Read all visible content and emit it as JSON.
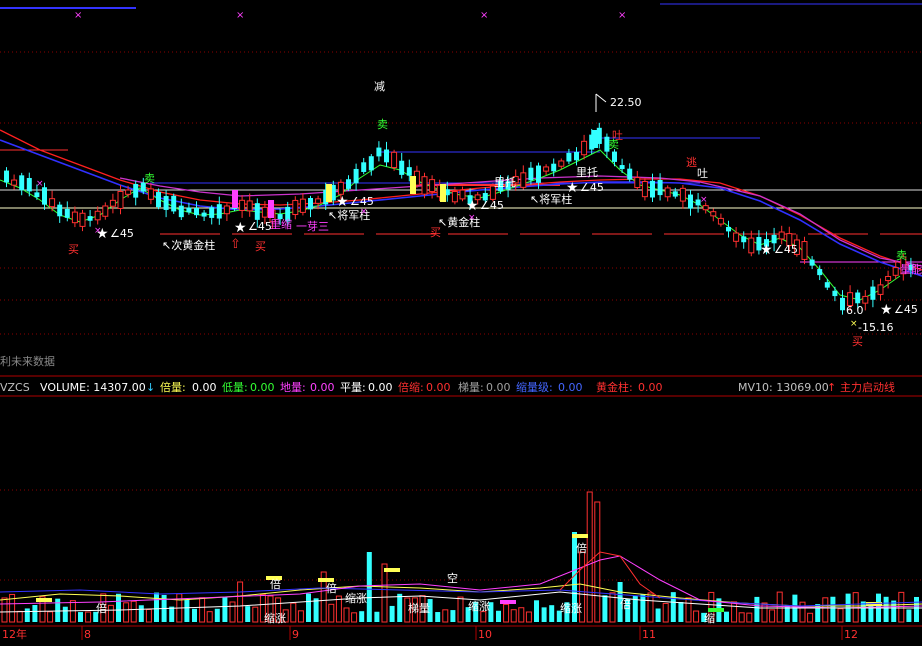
{
  "price_chart": {
    "notes": [
      {
        "text": "减",
        "color": "#ffffff"
      },
      {
        "text": "22.50",
        "color": "#ffffff"
      },
      {
        "text": "吐",
        "color": "#ff3030"
      },
      {
        "text": "逃",
        "color": "#ff3030"
      },
      {
        "text": "吐",
        "color": "#ffffff"
      },
      {
        "text": "卖",
        "color": "#33ff33"
      },
      {
        "text": "卖",
        "color": "#33ff33"
      },
      {
        "text": "卖",
        "color": "#33ff33"
      },
      {
        "text": "卖",
        "color": "#33ff33"
      },
      {
        "text": "∠45",
        "color": "#ffffff"
      },
      {
        "text": "↖次黄金柱",
        "color": "#ffffff"
      },
      {
        "text": "买",
        "color": "#ff3030"
      },
      {
        "text": "∠45",
        "color": "#ffffff"
      },
      {
        "text": "买",
        "color": "#ff3030"
      },
      {
        "text": "里缩",
        "color": "#ff40ff"
      },
      {
        "text": "一芽三",
        "color": "#ff40ff"
      },
      {
        "text": "∠45",
        "color": "#ffffff"
      },
      {
        "text": "↖将军柱",
        "color": "#ffffff"
      },
      {
        "text": "↖黄金柱",
        "color": "#ffffff"
      },
      {
        "text": "买",
        "color": "#ff3030"
      },
      {
        "text": "∠45",
        "color": "#ffffff"
      },
      {
        "text": "里托",
        "color": "#ffffff"
      },
      {
        "text": "∠45",
        "color": "#ffffff"
      },
      {
        "text": "↖将军柱",
        "color": "#ffffff"
      },
      {
        "text": "里托",
        "color": "#ffffff"
      },
      {
        "text": "∠45",
        "color": "#ffffff"
      },
      {
        "text": "6.0",
        "color": "#ffffff"
      },
      {
        "text": "∠45",
        "color": "#ffffff"
      },
      {
        "text": "-15.16",
        "color": "#ffffff"
      },
      {
        "text": "买",
        "color": "#ff3030"
      },
      {
        "text": "量能",
        "color": "#ff40ff"
      },
      {
        "text": "利未来数据",
        "color": "#888888"
      }
    ]
  },
  "indicator_bar": {
    "items": [
      {
        "label": "VZCS",
        "color": "#c0c0c0"
      },
      {
        "label": "VOLUME: 14307.00",
        "color": "#ffffff"
      },
      {
        "label": "↓",
        "color": "#33ccff"
      },
      {
        "label": "倍量:",
        "color": "#ffff55",
        "value": "0.00",
        "value_color": "#ffffff"
      },
      {
        "label": "低量:",
        "color": "#33ff33",
        "value": "0.00",
        "value_color": "#33ff33"
      },
      {
        "label": "地量:",
        "color": "#ff40ff",
        "value": "0.00",
        "value_color": "#ff40ff"
      },
      {
        "label": "平量:",
        "color": "#ffffff",
        "value": "0.00",
        "value_color": "#ffffff"
      },
      {
        "label": "倍缩:",
        "color": "#ff3030",
        "value": "0.00",
        "value_color": "#ff3030"
      },
      {
        "label": "梯量:",
        "color": "#a0a0a0",
        "value": "0.00",
        "value_color": "#a0a0a0"
      },
      {
        "label": "缩量级:",
        "color": "#4466ff",
        "value": "0.00",
        "value_color": "#4466ff"
      },
      {
        "label": "黄金柱:",
        "color": "#ff3030",
        "value": "0.00",
        "value_color": "#ff3030"
      },
      {
        "label": "MV10: 13069.00",
        "color": "#c0c0c0"
      },
      {
        "label": "↑",
        "color": "#ff3030"
      },
      {
        "label": "主力启动线",
        "color": "#ff3030"
      }
    ]
  },
  "volume_chart": {
    "notes": [
      {
        "text": "空",
        "color": "#ffffff"
      },
      {
        "text": "倍",
        "color": "#ffffff"
      },
      {
        "text": "倍",
        "color": "#ffffff"
      },
      {
        "text": "倍",
        "color": "#ffffff"
      },
      {
        "text": "倍",
        "color": "#ffffff"
      },
      {
        "text": "缩涨",
        "color": "#ffffff"
      },
      {
        "text": "缩涨",
        "color": "#ffffff"
      },
      {
        "text": "缩涨",
        "color": "#ffffff"
      },
      {
        "text": "缩涨",
        "color": "#ffffff"
      },
      {
        "text": "缩",
        "color": "#ffffff"
      },
      {
        "text": "梯量",
        "color": "#ffffff"
      },
      {
        "text": "倍",
        "color": "#ffffff"
      }
    ]
  },
  "time_axis": {
    "labels": [
      "12年",
      "8",
      "9",
      "10",
      "11",
      "12"
    ]
  },
  "colors": {
    "background": "#000000",
    "up": "#ff3030",
    "down": "#33ffff",
    "ma_red": "#ff2020",
    "ma_blue": "#3333ff",
    "ma_magenta": "#cc33cc",
    "ma_green": "#33ff33",
    "separator": "#b00000"
  }
}
